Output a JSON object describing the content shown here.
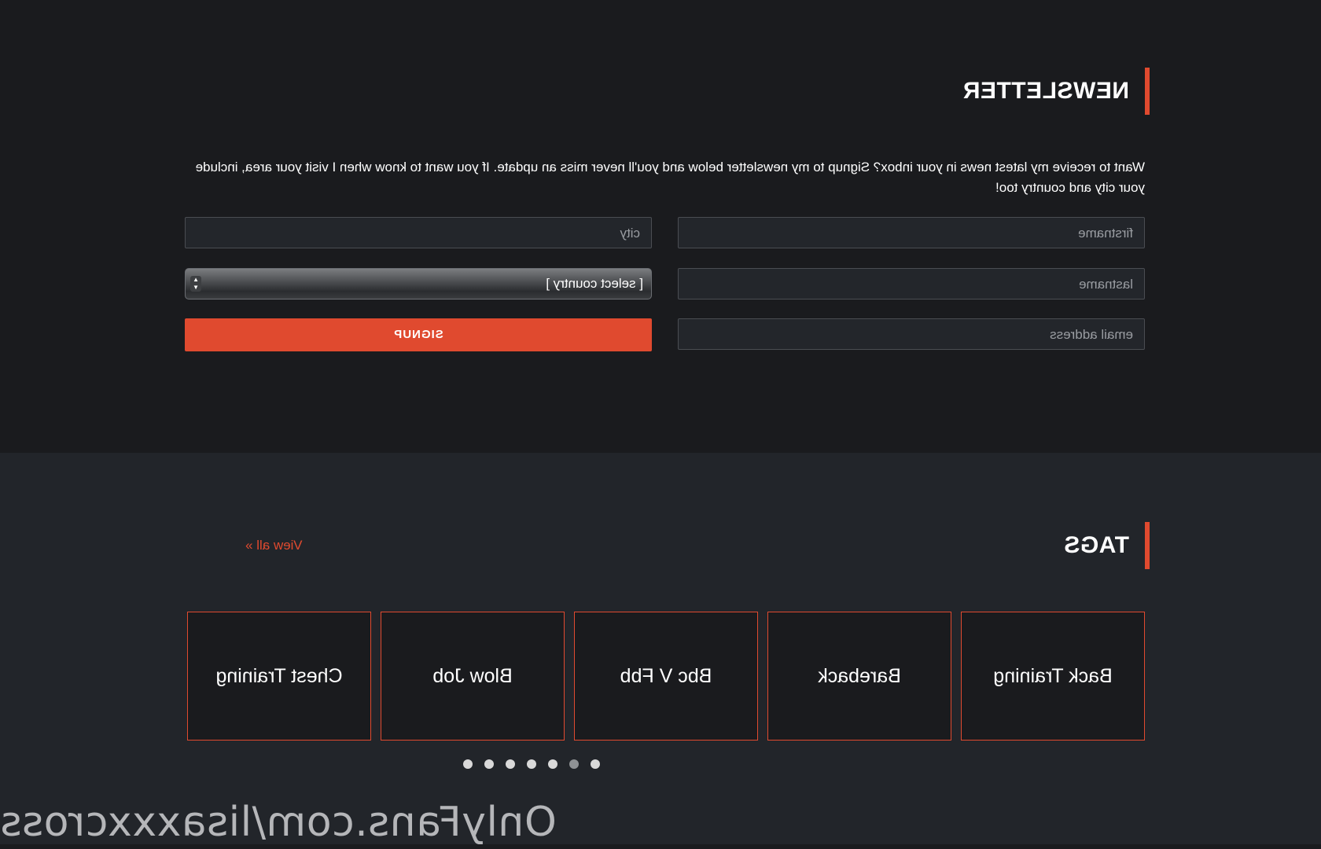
{
  "newsletter": {
    "title": "NEWSLETTER",
    "intro": "Want to receive my latest news in your inbox? Signup to my newsletter below and you'll never miss an update. If you want to know when I visit your area, include your city and country too!",
    "fields": {
      "firstname_placeholder": "firstname",
      "lastname_placeholder": "lastname",
      "email_placeholder": "email address",
      "city_placeholder": "city"
    },
    "country_select": {
      "selected": "[ select country ]"
    },
    "signup_label": "SIGNUP"
  },
  "tags": {
    "title": "TAGS",
    "view_all": "View all »",
    "items": [
      {
        "label": "Back Training"
      },
      {
        "label": "Bareback"
      },
      {
        "label": "Bbc V Fbb"
      },
      {
        "label": "Blow Job"
      },
      {
        "label": "Chest Training"
      }
    ],
    "carousel": {
      "page_count": 7,
      "active_index": 1
    }
  },
  "watermark": "OnlyFans.com/lisaxxxcross",
  "colors": {
    "accent": "#e04a2f",
    "background_dark": "#1a1b1e",
    "background_section": "#22252a"
  }
}
